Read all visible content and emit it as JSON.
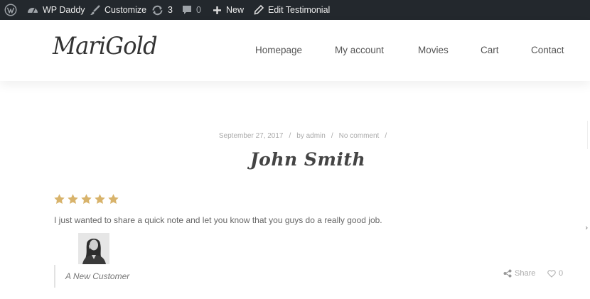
{
  "admin_bar": {
    "site_name": "WP Daddy",
    "customize": "Customize",
    "updates_count": "3",
    "comments_count": "0",
    "new": "New",
    "edit": "Edit Testimonial"
  },
  "header": {
    "logo": "MariGold",
    "nav": [
      "Homepage",
      "My account",
      "Movies",
      "Cart",
      "Contact"
    ]
  },
  "post": {
    "date": "September 27, 2017",
    "author": "by admin",
    "comments": "No comment",
    "separator": "/",
    "title": "John Smith",
    "rating": 5,
    "star_color": "#d8b36b",
    "quote": "I just wanted to share a quick note and let you know that you guys do a really good job.",
    "customer_label": "A New Customer",
    "share_label": "Share",
    "likes_count": "0"
  },
  "icons": [
    "wordpress-icon",
    "dashboard-icon",
    "brush-icon",
    "updates-icon",
    "comment-icon",
    "plus-icon",
    "pencil-icon",
    "star-icon",
    "share-icon",
    "heart-icon",
    "chevron-right-icon"
  ]
}
